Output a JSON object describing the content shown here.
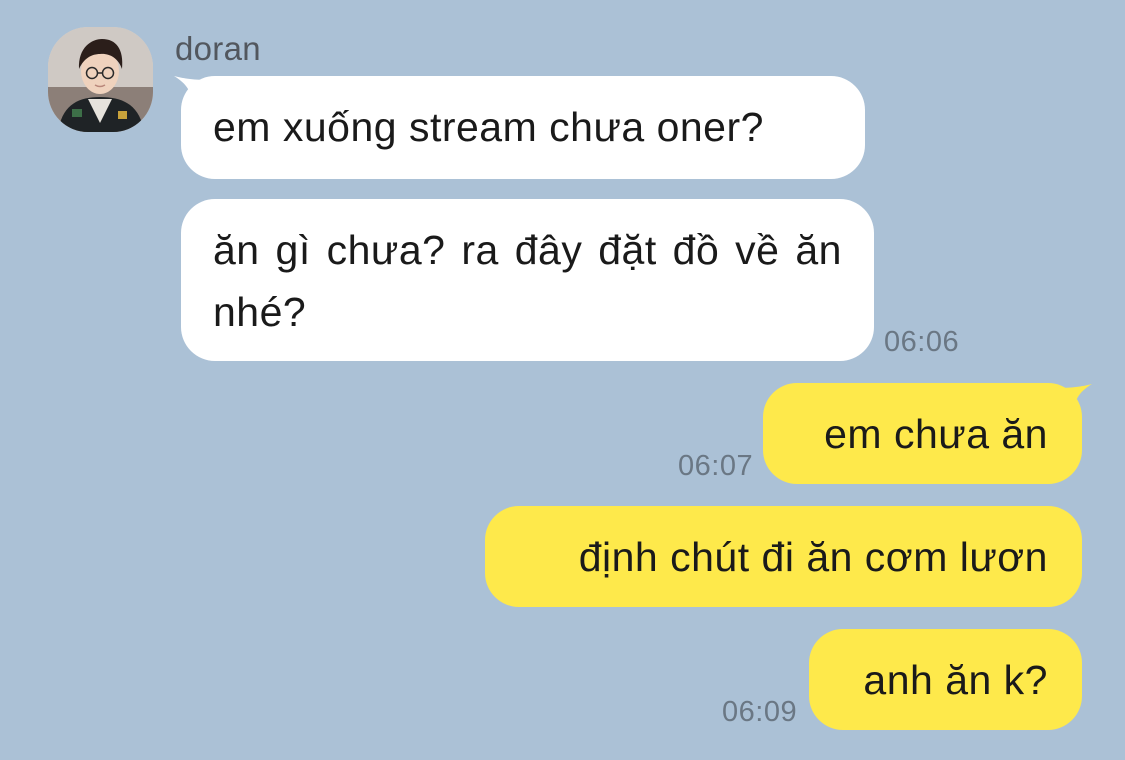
{
  "contact": {
    "name": "doran",
    "avatar_icon": "profile-photo"
  },
  "colors": {
    "background": "#abc1d6",
    "incoming_bubble": "#ffffff",
    "outgoing_bubble": "#fee94b",
    "timestamp": "#6a7784"
  },
  "messages": [
    {
      "direction": "incoming",
      "text": "em xuống stream chưa oner?"
    },
    {
      "direction": "incoming",
      "text": "ăn gì chưa? ra đây đặt đồ về ăn nhé?",
      "time": "06:06"
    },
    {
      "direction": "outgoing",
      "text": "em chưa ăn",
      "time": "06:07"
    },
    {
      "direction": "outgoing",
      "text": "định chút đi ăn cơm lươn"
    },
    {
      "direction": "outgoing",
      "text": "anh ăn k?",
      "time": "06:09"
    }
  ]
}
